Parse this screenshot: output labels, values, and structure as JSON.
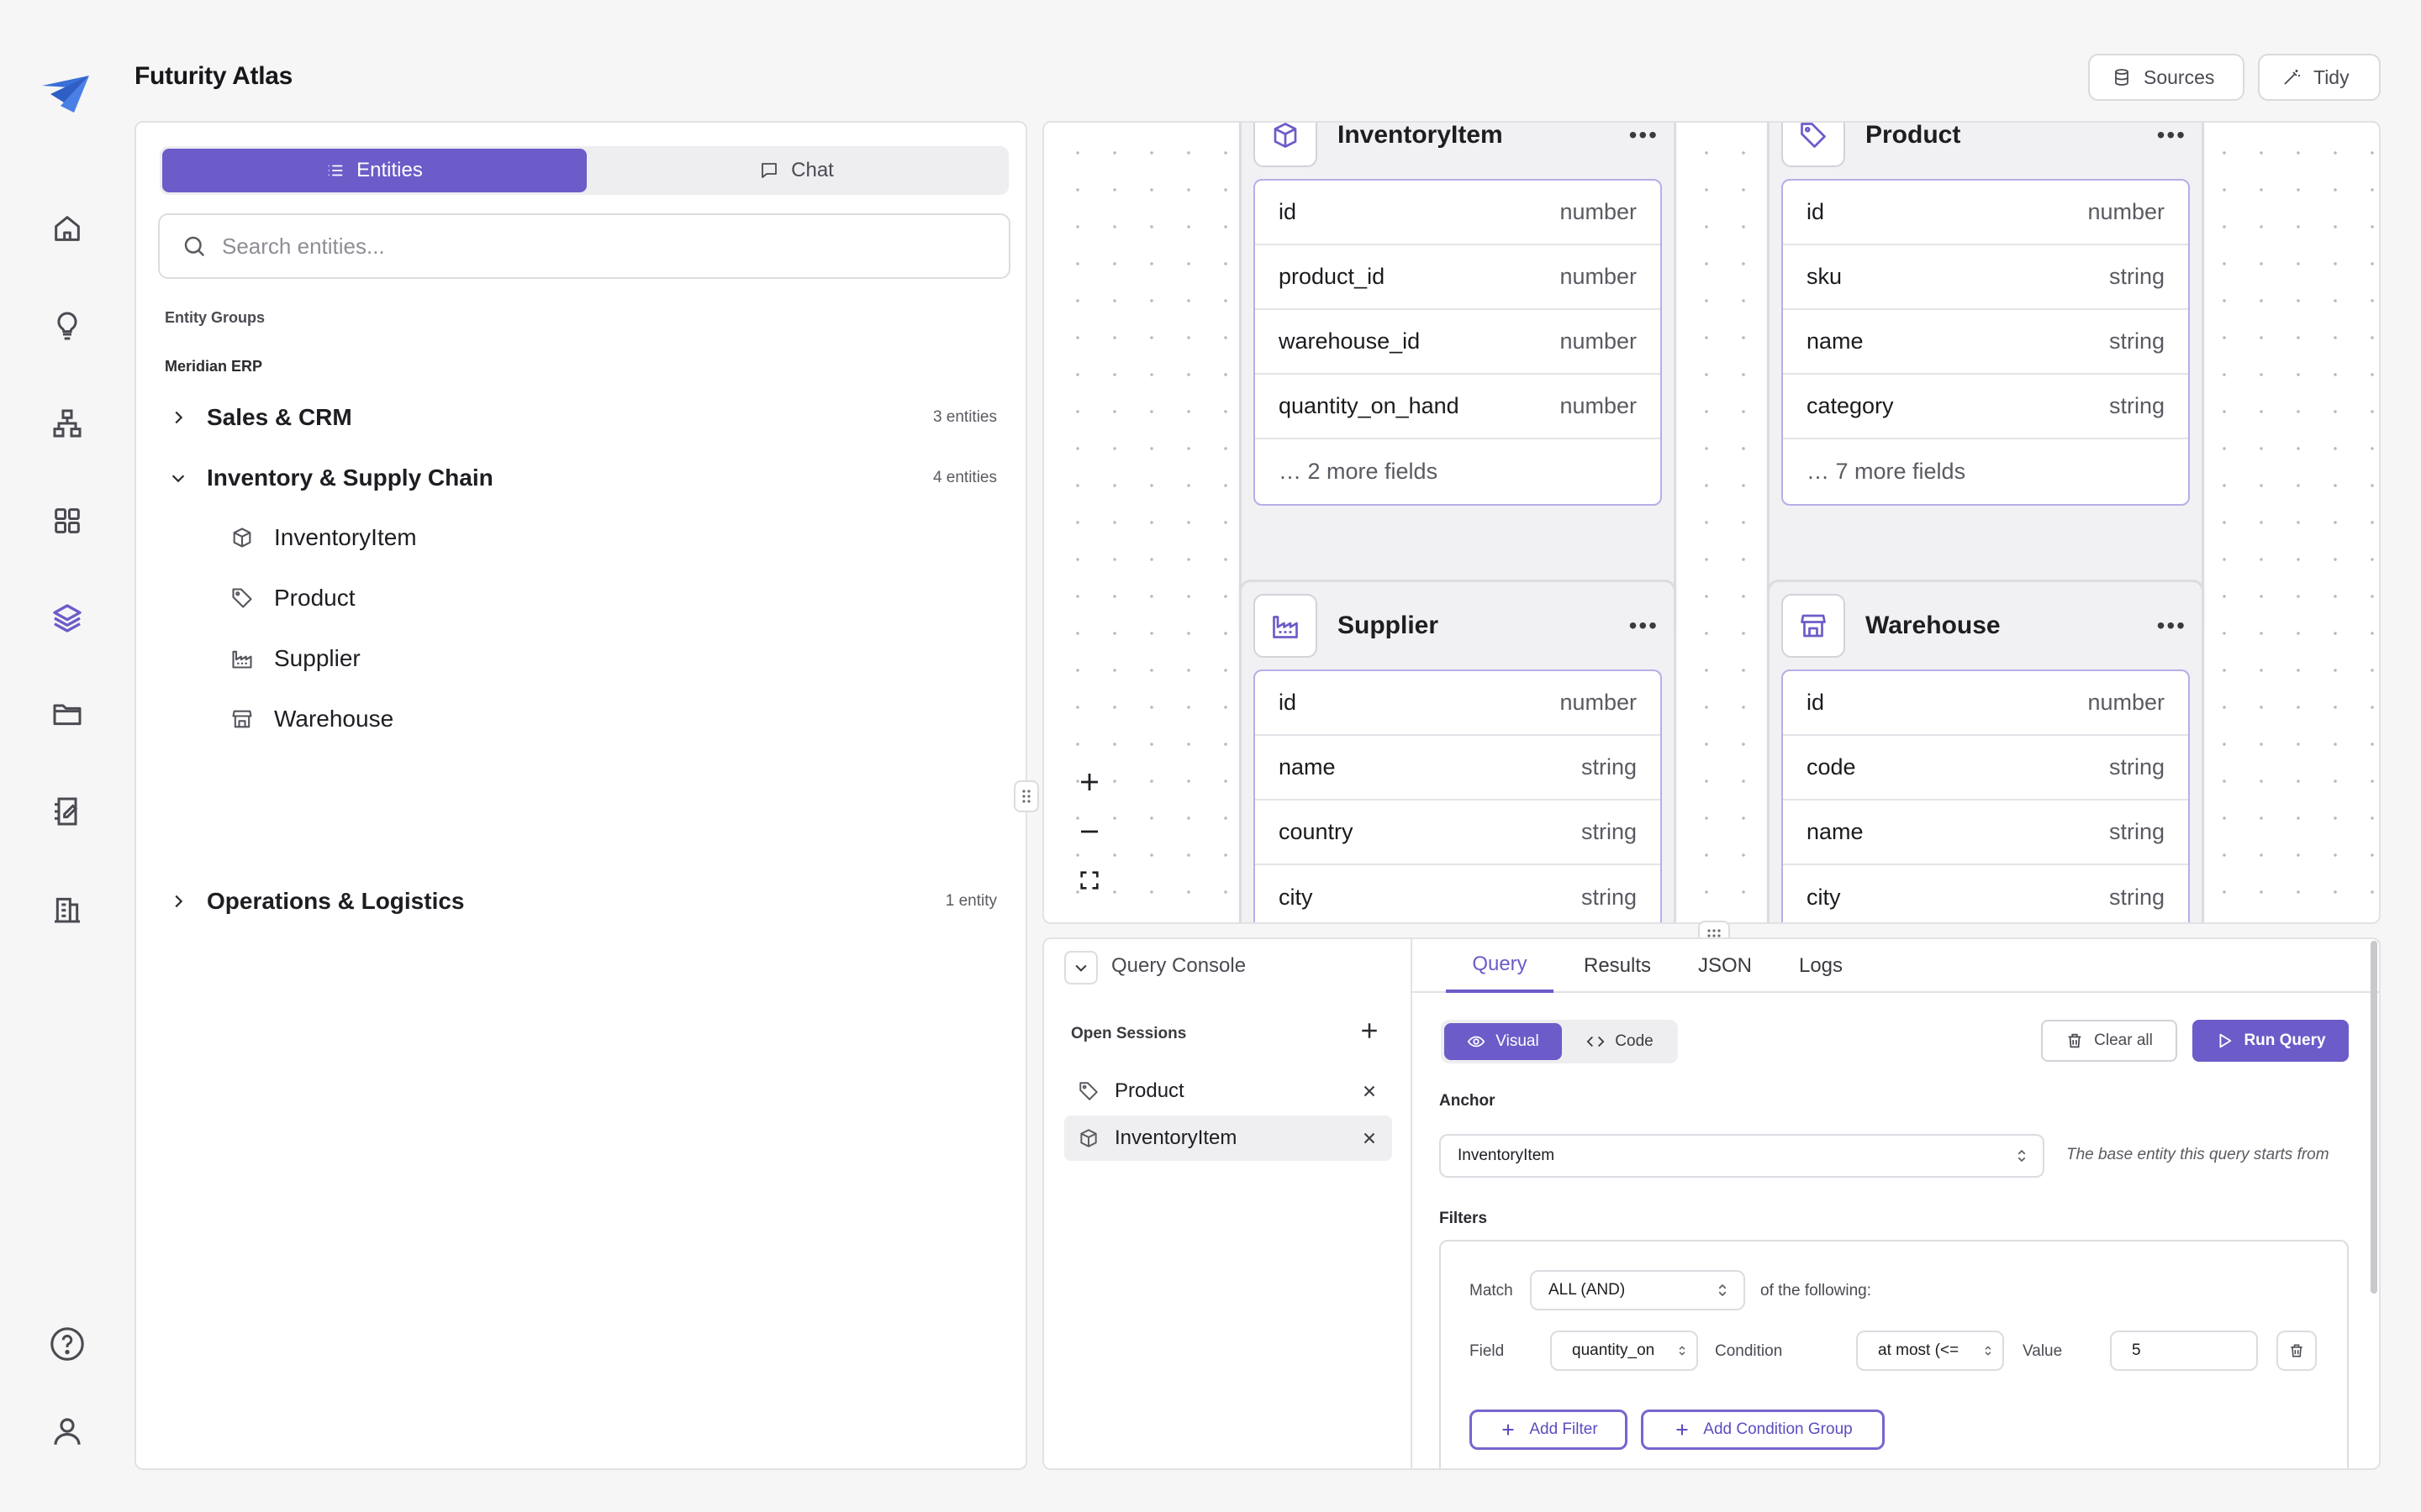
{
  "app": {
    "title": "Futurity Atlas"
  },
  "header": {
    "sources_label": "Sources",
    "tidy_label": "Tidy"
  },
  "rail": {
    "items": [
      "home-icon",
      "lightbulb-icon",
      "network-icon",
      "grid-icon",
      "layers-icon",
      "folder-icon",
      "notebook-icon",
      "building-icon"
    ],
    "bottom": [
      "help-icon",
      "user-icon"
    ],
    "active": "layers-icon"
  },
  "sidebar": {
    "tabs": {
      "entities": "Entities",
      "chat": "Chat"
    },
    "search_placeholder": "Search entities...",
    "section_label": "Entity Groups",
    "workspace": "Meridian ERP",
    "groups": [
      {
        "name": "Sales & CRM",
        "count": "3 entities",
        "expanded": false
      },
      {
        "name": "Inventory & Supply Chain",
        "count": "4 entities",
        "expanded": true,
        "entities": [
          "InventoryItem",
          "Product",
          "Supplier",
          "Warehouse"
        ]
      },
      {
        "name": "Operations & Logistics",
        "count": "1 entity",
        "expanded": false
      }
    ]
  },
  "canvas": {
    "cards": [
      {
        "name": "InventoryItem",
        "icon": "box-icon",
        "fields": [
          [
            "id",
            "number"
          ],
          [
            "product_id",
            "number"
          ],
          [
            "warehouse_id",
            "number"
          ],
          [
            "quantity_on_hand",
            "number"
          ]
        ],
        "more": "… 2 more fields"
      },
      {
        "name": "Product",
        "icon": "tag-icon",
        "fields": [
          [
            "id",
            "number"
          ],
          [
            "sku",
            "string"
          ],
          [
            "name",
            "string"
          ],
          [
            "category",
            "string"
          ]
        ],
        "more": "… 7 more fields"
      },
      {
        "name": "Supplier",
        "icon": "factory-icon",
        "fields": [
          [
            "id",
            "number"
          ],
          [
            "name",
            "string"
          ],
          [
            "country",
            "string"
          ],
          [
            "city",
            "string"
          ]
        ]
      },
      {
        "name": "Warehouse",
        "icon": "store-icon",
        "fields": [
          [
            "id",
            "number"
          ],
          [
            "code",
            "string"
          ],
          [
            "name",
            "string"
          ],
          [
            "city",
            "string"
          ]
        ]
      }
    ]
  },
  "console": {
    "title": "Query Console",
    "sessions_label": "Open Sessions",
    "sessions": [
      {
        "name": "Product",
        "icon": "tag-icon"
      },
      {
        "name": "InventoryItem",
        "icon": "box-icon",
        "active": true
      }
    ],
    "tabs": [
      "Query",
      "Results",
      "JSON",
      "Logs"
    ],
    "active_tab": "Query",
    "mode": {
      "visual": "Visual",
      "code": "Code",
      "active": "Visual"
    },
    "clear_label": "Clear all",
    "run_label": "Run Query",
    "anchor_label": "Anchor",
    "anchor_value": "InventoryItem",
    "anchor_hint": "The base entity this query starts from",
    "filters_label": "Filters",
    "match_label": "Match",
    "match_value": "ALL (AND)",
    "match_suffix": "of the following:",
    "filter": {
      "field_label": "Field",
      "field_value": "quantity_on",
      "condition_label": "Condition",
      "condition_value": "at most (<=",
      "value_label": "Value",
      "value": "5"
    },
    "add_filter": "Add Filter",
    "add_group": "Add Condition Group"
  },
  "colors": {
    "accent": "#6b5cc9",
    "accent_light": "#b7aee8"
  }
}
